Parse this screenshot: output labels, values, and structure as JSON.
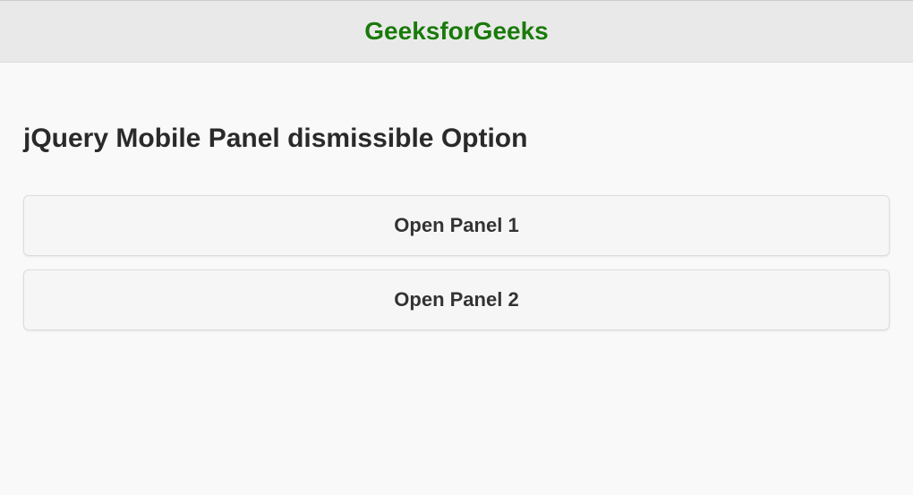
{
  "header": {
    "title": "GeeksforGeeks"
  },
  "main": {
    "heading": "jQuery Mobile Panel dismissible Option",
    "buttons": [
      {
        "label": "Open Panel 1"
      },
      {
        "label": "Open Panel 2"
      }
    ]
  }
}
